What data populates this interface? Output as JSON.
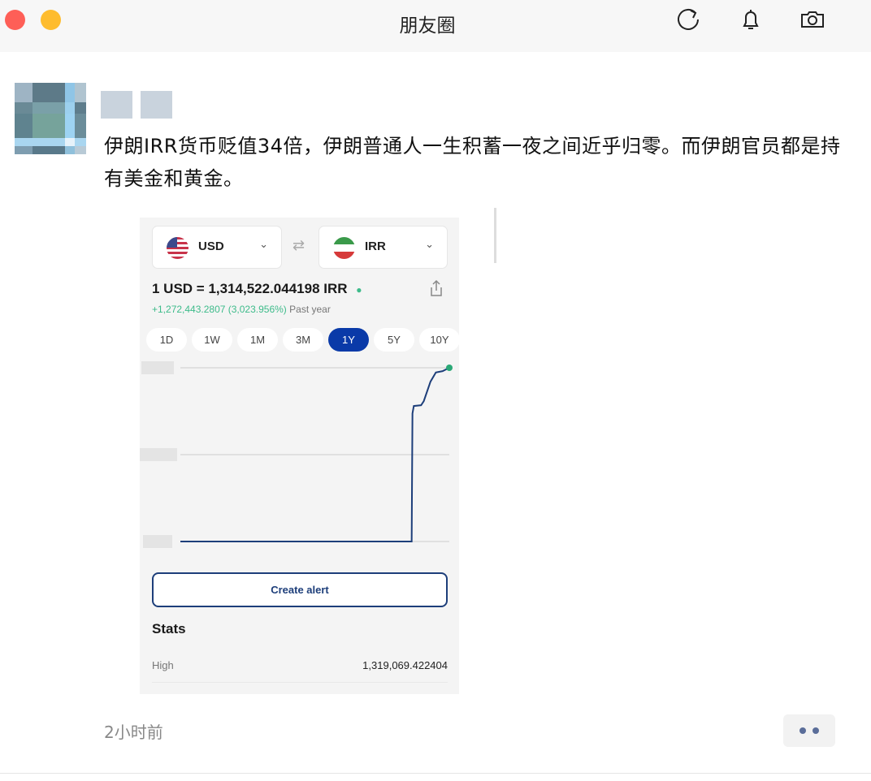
{
  "window": {
    "title": "朋友圈",
    "icons": [
      "refresh-icon",
      "bell-icon",
      "camera-icon"
    ]
  },
  "post": {
    "text": "伊朗IRR货币贬值34倍，伊朗普通人一生积蓄一夜之间近乎归零。而伊朗官员都是持有美金和黄金。",
    "time": "2小时前"
  },
  "screenshot": {
    "from_currency": "USD",
    "to_currency": "IRR",
    "rate": "1 USD = 1,314,522.044198 IRR",
    "change": "+1,272,443.2807 (3,023.956%)",
    "change_period": "Past year",
    "ranges": [
      "1D",
      "1W",
      "1M",
      "3M",
      "1Y",
      "5Y",
      "10Y"
    ],
    "active_range": "1Y",
    "create_alert": "Create alert",
    "stats_title": "Stats",
    "high_label": "High",
    "high_value": "1,319,069.422404",
    "colors": {
      "line": "#1d3e7a",
      "accent": "#0a3aa8",
      "positive": "#3dbb8a"
    }
  },
  "chart_data": {
    "type": "line",
    "title": "USD/IRR 1Y",
    "xlabel": "",
    "ylabel": "IRR",
    "x_unit": "percent of year",
    "x": [
      0,
      86,
      86.3,
      86.8,
      89.5,
      90.5,
      93,
      95,
      97.5,
      100
    ],
    "values": [
      42079,
      42079,
      980000,
      1034600,
      1040000,
      1070000,
      1213000,
      1280000,
      1290000,
      1314522
    ],
    "ylim": [
      42079,
      1314522
    ],
    "grid": true
  }
}
